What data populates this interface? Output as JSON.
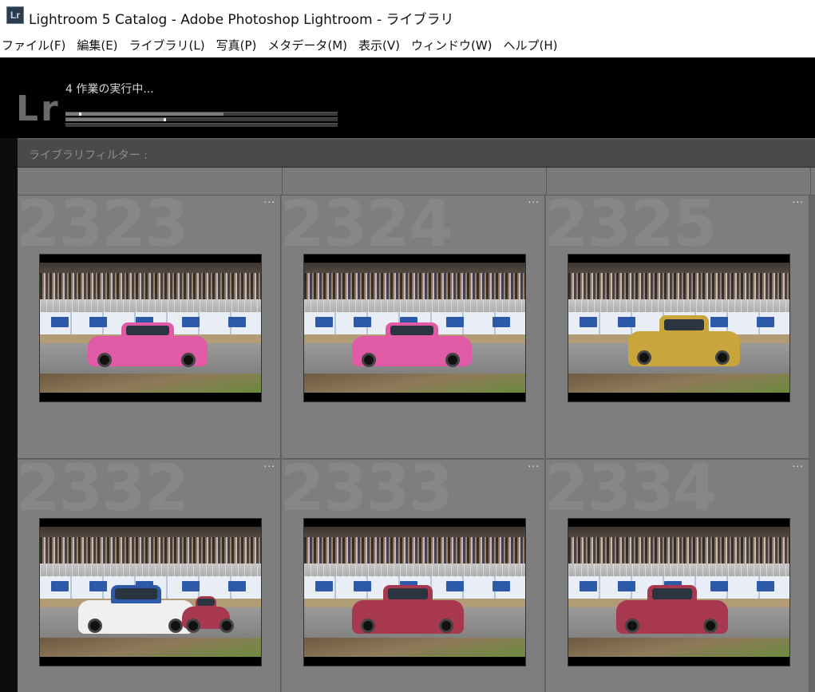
{
  "window": {
    "app_icon_text": "Lr",
    "title": "Lightroom 5 Catalog - Adobe Photoshop Lightroom - ライブラリ"
  },
  "menubar": {
    "items": [
      {
        "label": "ファイル(F)"
      },
      {
        "label": "編集(E)"
      },
      {
        "label": "ライブラリ(L)"
      },
      {
        "label": "写真(P)"
      },
      {
        "label": "メタデータ(M)"
      },
      {
        "label": "表示(V)"
      },
      {
        "label": "ウィンドウ(W)"
      },
      {
        "label": "ヘルプ(H)"
      }
    ]
  },
  "identity_plate": {
    "logo_text": "Lr",
    "task_status": "4 作業の実行中..."
  },
  "progress": {
    "bars": [
      {
        "fraction": 0.58,
        "marker": 0.05
      },
      {
        "fraction": 0.36,
        "marker": 0.36
      },
      {
        "fraction": 0.0,
        "marker": 0.0
      }
    ]
  },
  "filter_bar": {
    "label": "ライブラリフィルター :"
  },
  "grid": {
    "cells": [
      {
        "index": "2323",
        "options": "...",
        "car_color": "#e05aa6",
        "car_variant": "pink-wedge"
      },
      {
        "index": "2324",
        "options": "...",
        "car_color": "#e05aa6",
        "car_variant": "pink-wedge"
      },
      {
        "index": "2325",
        "options": "...",
        "car_color": "#c9a53b",
        "car_variant": "yellow-sedan"
      },
      {
        "index": "2332",
        "options": "...",
        "car_color": "#f0f0f0",
        "car_variant": "white-rally"
      },
      {
        "index": "2333",
        "options": "...",
        "car_color": "#a8384f",
        "car_variant": "red-coupe"
      },
      {
        "index": "2334",
        "options": "...",
        "car_color": "#a8384f",
        "car_variant": "red-coupe"
      }
    ]
  },
  "colors": {
    "title_bar": "#ffffff",
    "dark_panel": "#000000",
    "grid_cell": "#7e7e7e",
    "filter_bar": "#4a4a4a"
  }
}
